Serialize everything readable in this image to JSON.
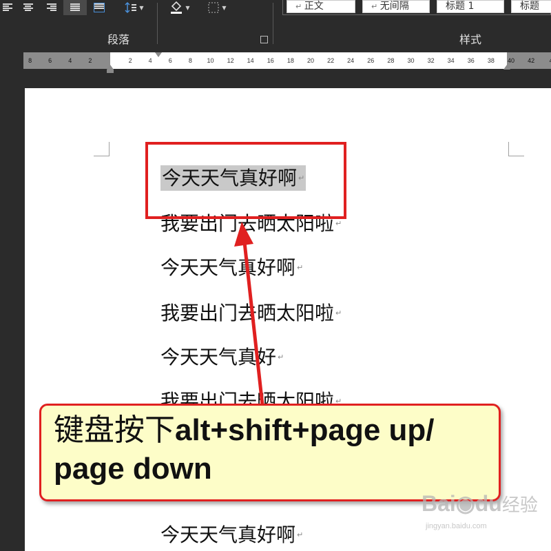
{
  "ribbon": {
    "paragraph_group_label": "段落",
    "styles_group_label": "样式",
    "styles": [
      "正文",
      "无间隔",
      "标题 1",
      "标题"
    ]
  },
  "ruler": {
    "left_labels": [
      "8",
      "6",
      "4",
      "2"
    ],
    "right_labels": [
      "2",
      "4",
      "6",
      "8",
      "10",
      "12",
      "14",
      "16",
      "18",
      "20",
      "22",
      "24",
      "26",
      "28",
      "30",
      "32",
      "34",
      "36",
      "38",
      "40",
      "42",
      "4"
    ]
  },
  "document": {
    "lines": [
      "今天天气真好啊",
      "我要出门去晒太阳啦",
      "今天天气真好啊",
      "我要出门去晒太阳啦",
      "今天天气真好",
      "我要出门去晒太阳啦",
      "今天天气真好啊"
    ],
    "paragraph_mark": "↵"
  },
  "annotation": {
    "callout_cn": "键盘按下",
    "callout_en_1": "alt+shift+page up/",
    "callout_en_2": "page down",
    "box_color": "#e02020",
    "callout_bg": "#fdfdc8"
  },
  "watermark": {
    "brand": "Bai",
    "brand2": "经验",
    "url": "jingyan.baidu.com"
  }
}
